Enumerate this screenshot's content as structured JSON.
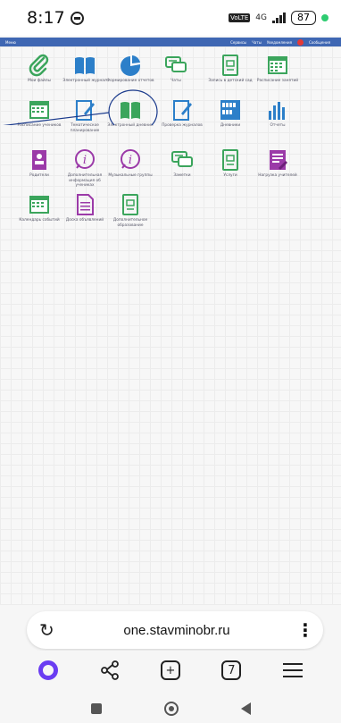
{
  "status": {
    "time": "8:17",
    "network": "4G",
    "lte": "VoLTE",
    "battery": "87"
  },
  "site_nav": {
    "items": [
      "Меню",
      "Сервисы",
      "Чаты",
      "Уведомления",
      "Сообщения"
    ],
    "badge": "1"
  },
  "tiles": [
    {
      "label": "Мои файлы",
      "icon": "paperclip-icon"
    },
    {
      "label": "Электронный журнал",
      "icon": "book-icon"
    },
    {
      "label": "Формирование отчетов",
      "icon": "pie-chart-icon"
    },
    {
      "label": "Чаты",
      "icon": "chat-icon"
    },
    {
      "label": "Запись в детский сад",
      "icon": "document-icon"
    },
    {
      "label": "Расписание занятий",
      "icon": "calendar-icon"
    },
    {
      "label": "Расписание учеников",
      "icon": "calendar-icon"
    },
    {
      "label": "Тематическое планирование",
      "icon": "edit-document-icon"
    },
    {
      "label": "Электронный дневник",
      "icon": "book-icon"
    },
    {
      "label": "Проверка журналов",
      "icon": "edit-document-icon"
    },
    {
      "label": "Дневники",
      "icon": "bookshelf-icon"
    },
    {
      "label": "Отчеты",
      "icon": "bar-chart-icon"
    },
    {
      "label": "Родители",
      "icon": "id-card-icon"
    },
    {
      "label": "Дополнительная информация об учениках",
      "icon": "info-icon"
    },
    {
      "label": "Музыкальные группы",
      "icon": "info-icon"
    },
    {
      "label": "Заметки",
      "icon": "chat-icon"
    },
    {
      "label": "Услуги",
      "icon": "document-icon"
    },
    {
      "label": "Нагрузка учителей",
      "icon": "checklist-icon"
    },
    {
      "label": "Календарь событий",
      "icon": "calendar-icon"
    },
    {
      "label": "Доска объявлений",
      "icon": "notice-board-icon"
    },
    {
      "label": "Дополнительное образование",
      "icon": "document-icon"
    }
  ],
  "browser": {
    "url": "one.stavminobr.ru",
    "tabs_count": "7"
  },
  "colors": {
    "accent_blue": "#3f67b3",
    "icon_blue": "#2c7fc9",
    "icon_green": "#3ba55c",
    "icon_purple": "#9b3aa8",
    "annotation": "#1a3a8c",
    "alice": "#6a3df2"
  }
}
